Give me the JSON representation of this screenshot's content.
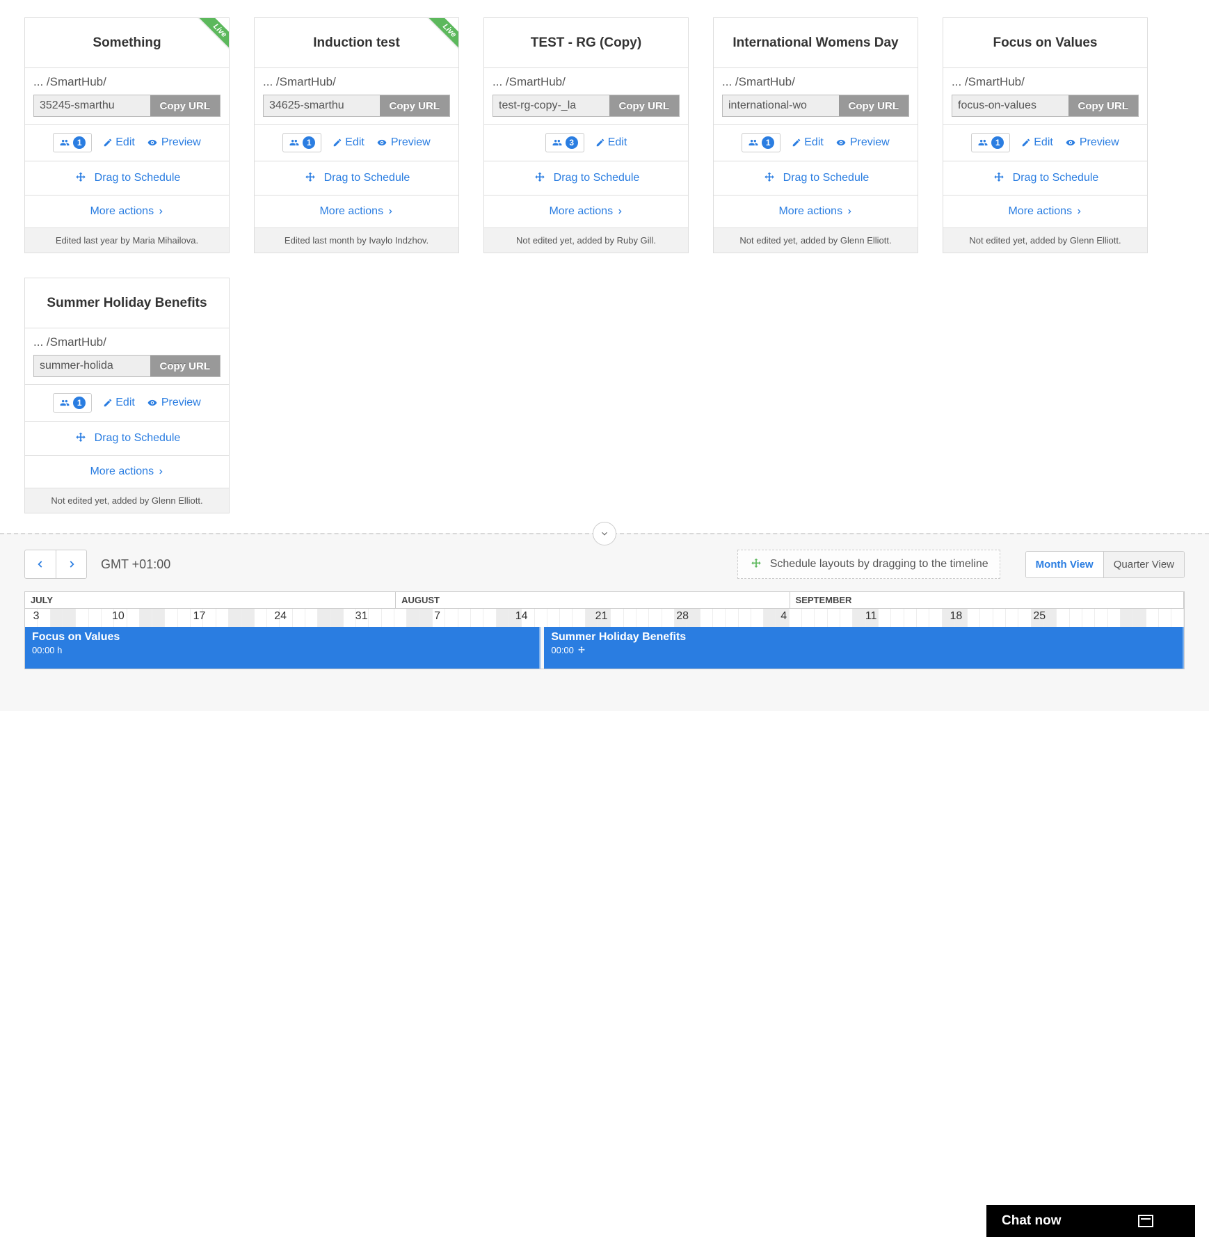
{
  "labels": {
    "copy": "Copy URL",
    "edit": "Edit",
    "preview": "Preview",
    "drag": "Drag to Schedule",
    "more": "More actions",
    "live": "Live"
  },
  "cards": [
    {
      "title": "Something",
      "live": true,
      "path": "... /SmartHub/",
      "slug": "35245-smarthu",
      "users": "1",
      "preview": true,
      "footer": "Edited last year by Maria Mihailova."
    },
    {
      "title": "Induction test",
      "live": true,
      "path": "... /SmartHub/",
      "slug": "34625-smarthu",
      "users": "1",
      "preview": true,
      "footer": "Edited last month by Ivaylo Indzhov."
    },
    {
      "title": "TEST - RG (Copy)",
      "live": false,
      "path": "... /SmartHub/",
      "slug": "test-rg-copy-_la",
      "users": "3",
      "preview": false,
      "footer": "Not edited yet, added by Ruby Gill."
    },
    {
      "title": "International Womens Day",
      "live": false,
      "path": "... /SmartHub/",
      "slug": "international-wo",
      "users": "1",
      "preview": true,
      "footer": "Not edited yet, added by Glenn Elliott."
    },
    {
      "title": "Focus on Values",
      "live": false,
      "path": "... /SmartHub/",
      "slug": "focus-on-values",
      "users": "1",
      "preview": true,
      "footer": "Not edited yet, added by Glenn Elliott."
    },
    {
      "title": "Summer Holiday Benefits",
      "live": false,
      "path": "... /SmartHub/",
      "slug": "summer-holida",
      "users": "1",
      "preview": true,
      "footer": "Not edited yet, added by Glenn Elliott."
    }
  ],
  "timeline": {
    "tz": "GMT +01:00",
    "hint": "Schedule layouts by dragging to the timeline",
    "view_month": "Month View",
    "view_quarter": "Quarter View",
    "months": [
      "JULY",
      "AUGUST",
      "SEPTEMBER"
    ],
    "day_ticks": [
      "3",
      "10",
      "17",
      "24",
      "31",
      "7",
      "14",
      "21",
      "28",
      "4",
      "11",
      "18",
      "25"
    ],
    "events": [
      {
        "title": "Focus on Values",
        "time": "00:00  h"
      },
      {
        "title": "Summer Holiday Benefits",
        "time": "00:00"
      }
    ]
  },
  "chat": {
    "label": "Chat now"
  }
}
